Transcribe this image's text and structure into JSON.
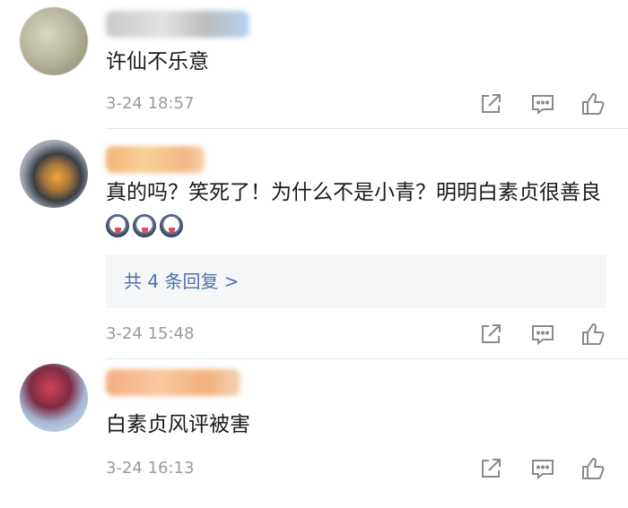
{
  "comments": [
    {
      "text": "许仙不乐意",
      "time": "3-24 18:57"
    },
    {
      "text": "真的吗？笑死了！为什么不是小青？明明白素贞很善良",
      "emoji_count": 3,
      "emoji_icon": "panda-face-emoji",
      "replies_label": "共 4 条回复 >",
      "time": "3-24 15:48"
    },
    {
      "text": "白素贞风评被害",
      "time": "3-24 16:13"
    }
  ],
  "icons": {
    "share": "share-icon",
    "comment": "comment-icon",
    "like": "thumbs-up-icon"
  },
  "colors": {
    "link": "#4f72a8",
    "timestamp": "#9a9a9a",
    "reply_bg": "#f5f6f8"
  }
}
